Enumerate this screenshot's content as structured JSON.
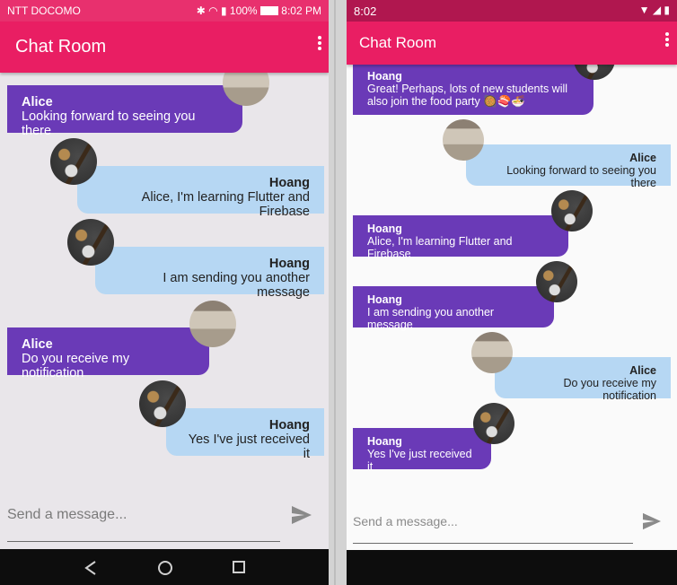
{
  "left_screen": {
    "status": {
      "carrier": "NTT DOCOMO",
      "battery": "100%",
      "time": "8:02 PM"
    },
    "appbar": {
      "title": "Chat Room"
    },
    "messages": [
      {
        "sender": "Alice",
        "text": "Looking forward to seeing you there"
      },
      {
        "sender": "Hoang",
        "text": "Alice, I'm learning Flutter and Firebase"
      },
      {
        "sender": "Hoang",
        "text": "I am sending you another message"
      },
      {
        "sender": "Alice",
        "text": "Do you receive my notification"
      },
      {
        "sender": "Hoang",
        "text": "Yes I've just received it"
      }
    ],
    "input": {
      "placeholder": "Send a message..."
    }
  },
  "right_screen": {
    "status": {
      "time": "8:02"
    },
    "appbar": {
      "title": "Chat Room"
    },
    "messages": [
      {
        "sender": "Hoang",
        "text": "Great! Perhaps, lots of new students will",
        "text2": "also join the food party 🥘🍣🍜"
      },
      {
        "sender": "Alice",
        "text": "Looking forward to seeing you there"
      },
      {
        "sender": "Hoang",
        "text": "Alice, I'm learning Flutter and Firebase"
      },
      {
        "sender": "Hoang",
        "text": "I am sending you another message"
      },
      {
        "sender": "Alice",
        "text": "Do you receive my notification"
      },
      {
        "sender": "Hoang",
        "text": "Yes I've just received it"
      }
    ],
    "input": {
      "placeholder": "Send a message..."
    }
  },
  "icons": {
    "more": "more-vert-icon",
    "send": "send-icon",
    "nav": [
      "back-icon",
      "home-icon",
      "recents-icon"
    ],
    "status": [
      "bluetooth-icon",
      "wifi-icon",
      "signal-icon",
      "battery-icon"
    ]
  },
  "colors": {
    "primary": "#e91e63",
    "status_android": "#b0174f",
    "purple_bubble": "#6a3ab7",
    "blue_bubble": "#b6d7f3"
  }
}
